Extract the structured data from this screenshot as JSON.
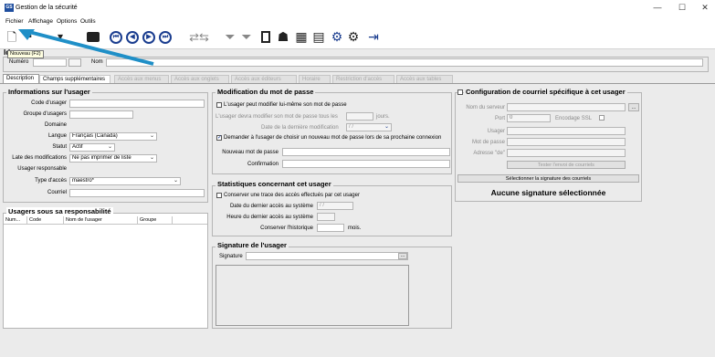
{
  "window": {
    "title": "Gestion de la sécurité",
    "app_icon_text": "GS",
    "min": "—",
    "max": "☐",
    "close": "✕"
  },
  "menu": [
    "Fichier",
    "Affichage",
    "Options",
    "Outils"
  ],
  "toolbar": {
    "tooltip": "Nouveau (F2)",
    "icons": [
      "new-icon",
      "save-icon",
      "filter-icon",
      "briefcase-icon",
      "first-record-icon",
      "previous-record-icon",
      "next-record-icon",
      "last-record-icon",
      "transfer-icon",
      "funnel-icon",
      "funnel-clear-icon",
      "id-card-icon",
      "users-icon",
      "grid-icon",
      "report-icon",
      "gear-icon",
      "gear-dark-icon",
      "export-icon"
    ],
    "nav": [
      "⏮",
      "◀",
      "▶",
      "⏭"
    ]
  },
  "identity": {
    "section_label": "Id",
    "numero_label": "Numéro",
    "numero_value": "",
    "nom_label": "Nom",
    "nom_value": ""
  },
  "tabs": [
    "Description",
    "Champs supplémentaires",
    "Accès aux menus",
    "Accès aux onglets",
    "Accès aux éditeurs",
    "Horaire",
    "Restriction d'accès",
    "Accès aux tables"
  ],
  "info": {
    "title": "Informations sur l'usager",
    "code_label": "Code d'usager",
    "code_value": "",
    "groupe_label": "Groupe d'usagers",
    "groupe_value": "",
    "domaine_label": "Domaine",
    "langue_label": "Langue",
    "langue_value": "Français (Canada)",
    "statut_label": "Statut",
    "statut_value": "Actif",
    "late_label": "Late des modifications",
    "late_value": "Ne pas imprimer de liste",
    "resp_label": "Usager responsable",
    "type_label": "Type d'accès",
    "type_value": "maestro*",
    "courriel_label": "Courriel",
    "courriel_value": ""
  },
  "subordinates": {
    "title": "Usagers sous sa responsabilité",
    "columns": [
      "Num...",
      "Code",
      "Nom de l'usager",
      "Groupe"
    ]
  },
  "password": {
    "title": "Modification du mot de passe",
    "can_modify_label": "L'usager peut modifier lui-même son mot de passe",
    "must_change_label": "L'usager devra modifier son mot de passe tous les",
    "days_label": "jours.",
    "last_change_label": "Date de la dernière modification",
    "last_change_value": "/ /",
    "ask_label": "Demander à l'usager de choisir un nouveau mot de passe lors de sa prochaine connexion",
    "new_label": "Nouveau mot de passe",
    "confirm_label": "Confirmation"
  },
  "stats": {
    "title": "Statistiques concernant cet usager",
    "keep_trace_label": "Conserver une trace des accès effectués par cet usager",
    "last_date_label": "Date du dernier accès au système",
    "last_date_value": "/ /",
    "last_hour_label": "Heure du dernier accès au système",
    "keep_hist_label": "Conserver l'historique",
    "months_label": "mois."
  },
  "signature": {
    "title": "Signature de l'usager",
    "field_label": "Signature",
    "browse": "..."
  },
  "mail": {
    "title": "Configuration de courriel spécifique à cet usager",
    "server_label": "Nom du serveur",
    "browse": "...",
    "port_label": "Port",
    "port_value": "0",
    "ssl_label": "Encodage SSL",
    "user_label": "Usager",
    "pwd_label": "Mot de passe",
    "from_label": "Adresse \"de\"",
    "test_button": "Tester l'envoi de courriels",
    "select_sig_button": "Sélectionner la signature des courriels",
    "no_sig_text": "Aucune signature sélectionnée"
  },
  "colors": {
    "accent": "#1a3d8f",
    "arrow": "#1f8fc7"
  }
}
